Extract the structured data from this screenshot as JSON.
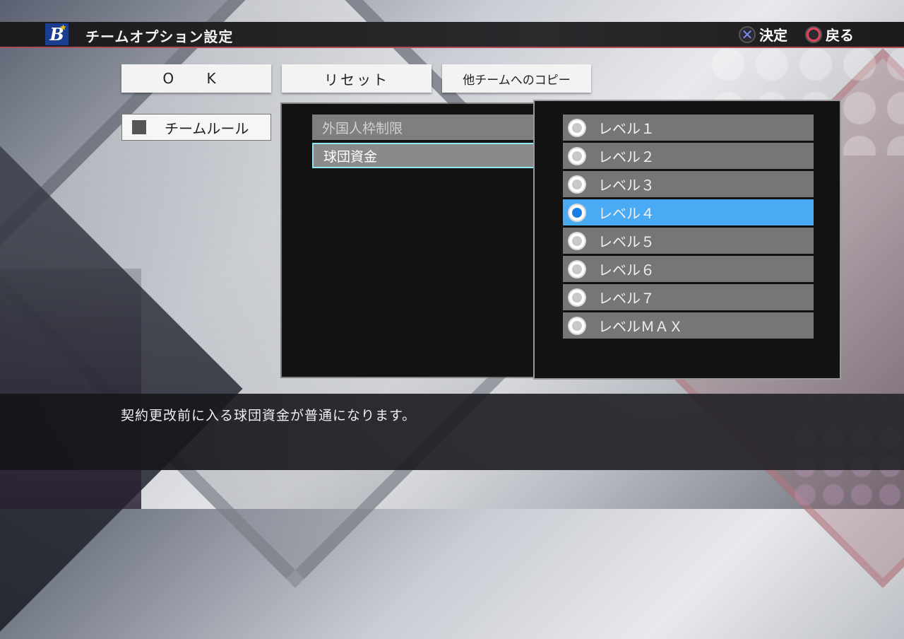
{
  "header": {
    "title": "チームオプション設定",
    "logo_letter": "B",
    "hints": {
      "confirm_label": "決定",
      "back_label": "戻る"
    }
  },
  "buttons": {
    "ok": "O K",
    "reset": "リセット",
    "copy": "他チームへのコピー"
  },
  "category_tab": "チームルール",
  "settings": [
    {
      "label": "外国人枠制限"
    },
    {
      "label": "球団資金"
    }
  ],
  "options": [
    {
      "label": "レベル１",
      "selected": false
    },
    {
      "label": "レベル２",
      "selected": false
    },
    {
      "label": "レベル３",
      "selected": false
    },
    {
      "label": "レベル４",
      "selected": true
    },
    {
      "label": "レベル５",
      "selected": false
    },
    {
      "label": "レベル６",
      "selected": false
    },
    {
      "label": "レベル７",
      "selected": false
    },
    {
      "label": "レベルＭＡＸ",
      "selected": false
    }
  ],
  "description": "契約更改前に入る球団資金が普通になります。",
  "colors": {
    "selected_option": "#4aaaf4",
    "focus_border": "#8fe6f2",
    "header_accent": "#b04a55",
    "logo_bg": "#1a3d8f"
  }
}
